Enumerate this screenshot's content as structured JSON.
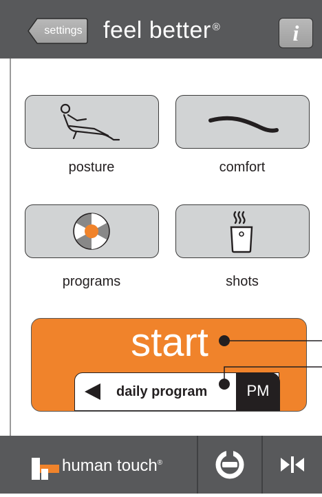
{
  "header": {
    "back_label": "settings",
    "title": "feel better",
    "title_mark": "®",
    "info_label": "i"
  },
  "tiles": {
    "posture": {
      "label": "posture",
      "icon": "recliner-posture-icon"
    },
    "comfort": {
      "label": "comfort",
      "icon": "wave-curve-icon"
    },
    "programs": {
      "label": "programs",
      "icon": "program-disc-icon"
    },
    "shots": {
      "label": "shots",
      "icon": "steaming-cup-icon"
    }
  },
  "start_panel": {
    "start_label": "start",
    "program_label": "daily program",
    "period_label": "PM"
  },
  "footer": {
    "brand_label": "human touch",
    "brand_mark": "®",
    "button_a_icon": "power-circle-icon",
    "button_b_icon": "play-pause-icon"
  },
  "colors": {
    "header": "#58595b",
    "accent": "#f0832b",
    "tile": "#d1d3d4",
    "dark": "#231f20"
  }
}
